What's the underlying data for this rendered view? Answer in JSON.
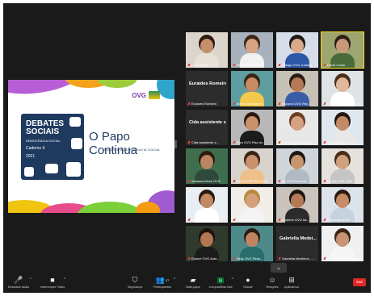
{
  "slide": {
    "logo_text": "OVG",
    "puzzle_title": "DEBATES SOCIAIS",
    "puzzle_subtitle": "DEMOCRACIA SOCIAL",
    "puzzle_caderno": "Caderno 5",
    "puzzle_year": "2021",
    "heading": "O Papo Continua",
    "subheading": "A LOAS E A DEMOCRACIA SOCIAL"
  },
  "participants": [
    {
      "name": "Lucia Araujo",
      "video": true,
      "mic_off": true,
      "skin": "#c68f6b",
      "hair": "#2b1a12",
      "shirt": "#e8e1d8",
      "bg": "#dcd5cb"
    },
    {
      "name": "Valeria OVG POR...",
      "video": true,
      "mic_off": true,
      "skin": "#d7a383",
      "hair": "#3c2717",
      "shirt": "#f1f1f1",
      "bg": "#a8b2bd"
    },
    {
      "name": "Thiago OVG Judaiva",
      "video": true,
      "mic_off": true,
      "skin": "#d9a98b",
      "hair": "#1f1a18",
      "shirt": "#2d57a7",
      "bg": "#d6dde8"
    },
    {
      "name": "David Costa",
      "video": true,
      "mic_off": true,
      "skin": "#c89a7a",
      "hair": "#2a2018",
      "shirt": "#4a6b3a",
      "bg": "#9fa56e",
      "active": true
    },
    {
      "name": "Eurades Romeiro",
      "video": false,
      "display": "Euraides Romeiro",
      "mic_off": true
    },
    {
      "name": "Marise Bernardes",
      "video": true,
      "mic_off": true,
      "skin": "#c88a60",
      "hair": "#3b2418",
      "shirt": "#f2c94c",
      "bg": "#5f9ea0"
    },
    {
      "name": "Socorro OVG Rep...",
      "video": true,
      "mic_off": true,
      "skin": "#b57a55",
      "hair": "#2a1b12",
      "shirt": "#3b5ca8",
      "bg": "#c7c1b5"
    },
    {
      "name": "Fernanda Lopes do pu...",
      "video": true,
      "mic_off": true,
      "skin": "#e0b89b",
      "hair": "#4b2e1a",
      "shirt": "#ffffff",
      "bg": "#dfe3e6"
    },
    {
      "name": "Cida assistente s...",
      "video": false,
      "display": "Cida assistente s...",
      "mic_off": true
    },
    {
      "name": "Elza OVG Riso do ...",
      "video": true,
      "mic_off": true,
      "skin": "#c9906b",
      "hair": "#2a1a14",
      "shirt": "#1c1c1c",
      "bg": "#b8b8b8"
    },
    {
      "name": "Lidia Belem OVG Go...",
      "video": true,
      "mic_off": true,
      "skin": "#d5a282",
      "hair": "#6b3f22",
      "shirt": "#e7e7e7",
      "bg": "#e8e8e8"
    },
    {
      "name": "Thayze Melo OVG S...",
      "video": true,
      "mic_off": true,
      "skin": "#c48a65",
      "hair": "#231710",
      "shirt": "#e8e8e8",
      "bg": "#e1e7ef"
    },
    {
      "name": "Vanessa Alves OVG",
      "video": true,
      "mic_off": true,
      "skin": "#b98563",
      "hair": "#2d1b10",
      "shirt": "#2d4a3a",
      "bg": "#3f6e4e"
    },
    {
      "name": "Elane OVG Rio Verde",
      "video": true,
      "mic_off": true,
      "skin": "#c9916e",
      "hair": "#3a2314",
      "shirt": "#f0c08a",
      "bg": "#d8d4cd"
    },
    {
      "name": "Eli OVG Mineiros",
      "video": true,
      "mic_off": true,
      "skin": "#c8956f",
      "hair": "#1f1712",
      "shirt": "#b1b9c2",
      "bg": "#cfd5da"
    },
    {
      "name": "Lenira OVG Jatai",
      "video": true,
      "mic_off": true,
      "skin": "#d0a07d",
      "hair": "#4a2c18",
      "shirt": "#c5c5c5",
      "bg": "#e5e2de"
    },
    {
      "name": "Marcia OVG - Porto",
      "video": true,
      "mic_off": true,
      "skin": "#c38962",
      "hair": "#2a1a12",
      "shirt": "#ffffff",
      "bg": "#e9eef3"
    },
    {
      "name": "Sandra OVG",
      "video": true,
      "mic_off": true,
      "skin": "#d4a07c",
      "hair": "#b98a3e",
      "shirt": "#f4f4f4",
      "bg": "#f1eee9"
    },
    {
      "name": "Lucilene OVG Ita...",
      "video": true,
      "mic_off": true,
      "skin": "#b57a55",
      "hair": "#1e1410",
      "shirt": "#2b2b2b",
      "bg": "#cac4bc"
    },
    {
      "name": "Fernanda OVG ...",
      "video": true,
      "mic_off": true,
      "skin": "#c68c67",
      "hair": "#2c1b12",
      "shirt": "#c7d2df",
      "bg": "#dde3ea"
    },
    {
      "name": "Eunice OVG Auto...",
      "video": true,
      "mic_off": true,
      "skin": "#b27652",
      "hair": "#1b120d",
      "shirt": "#1c1c1c",
      "bg": "#2f3a2c"
    },
    {
      "name": "Kelly OVG Pires...",
      "video": true,
      "mic_off": true,
      "skin": "#c08560",
      "hair": "#2a1b12",
      "shirt": "#2a6d6d",
      "bg": "#4f8a8b"
    },
    {
      "name": "Gabriella Medeiros - ...",
      "video": false,
      "display": "Gabriella Medei...",
      "mic_off": true
    },
    {
      "name": "ROSICLER OVG Goias",
      "video": true,
      "mic_off": true,
      "skin": "#c99473",
      "hair": "#3b2618",
      "shirt": "#f5f5f5",
      "bg": "#eef0f2"
    }
  ],
  "toolbar": {
    "items": [
      {
        "label": "Desativar áudio",
        "icon": "microphone-icon",
        "glyph": "🎤",
        "caret": true
      },
      {
        "label": "Interromper Vídeo",
        "icon": "video-camera-icon",
        "glyph": "■",
        "caret": true
      },
      {
        "label": "Segurança",
        "icon": "shield-icon",
        "glyph": "⛉",
        "caret": false
      },
      {
        "label": "Participantes",
        "icon": "participants-icon",
        "glyph": "👥",
        "count": "37",
        "caret": true
      },
      {
        "label": "Bate-papo",
        "icon": "chat-icon",
        "glyph": "▰",
        "caret": false
      },
      {
        "label": "Compartilhar tela",
        "icon": "share-screen-icon",
        "glyph": "▣",
        "caret": true
      },
      {
        "label": "Gravar",
        "icon": "record-icon",
        "glyph": "●",
        "caret": false
      },
      {
        "label": "Reações",
        "icon": "reactions-icon",
        "glyph": "☺",
        "caret": false
      },
      {
        "label": "Aplicativos",
        "icon": "apps-icon",
        "glyph": "⊞",
        "caret": false
      }
    ],
    "end_label": "Sair"
  },
  "gallery_next": "⌄"
}
